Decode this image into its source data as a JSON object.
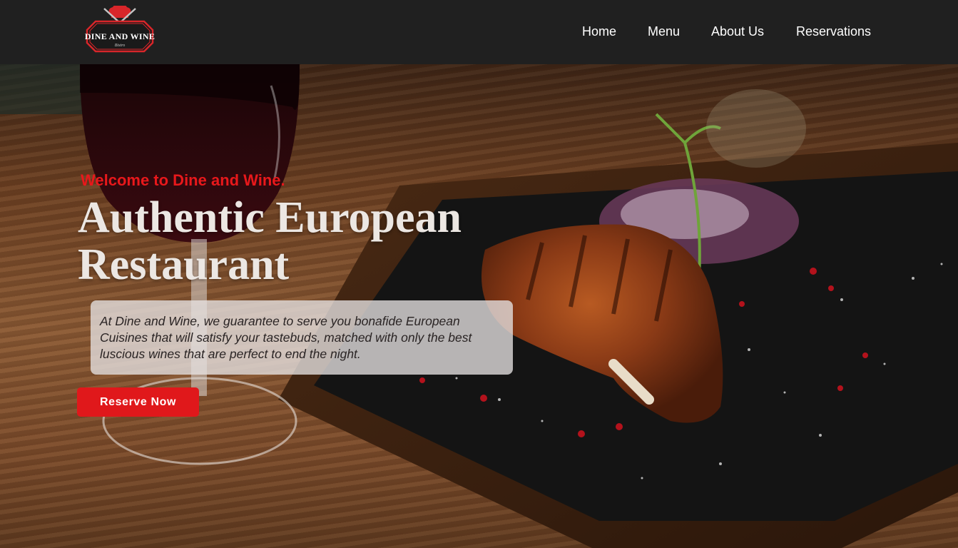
{
  "brand": {
    "logo_text": "DINE AND WINE",
    "logo_subtext": "Bistro",
    "accent_color": "#e0181b"
  },
  "nav": {
    "items": [
      {
        "label": "Home"
      },
      {
        "label": "Menu"
      },
      {
        "label": "About Us"
      },
      {
        "label": "Reservations"
      }
    ]
  },
  "hero": {
    "welcome": "Welcome to Dine and Wine.",
    "headline_line1": "Authentic European",
    "headline_line2": "Restaurant",
    "description": "At Dine and Wine, we guarantee to serve you bonafide European Cuisines that will satisfy your tastebuds, matched with only the best luscious wines that are perfect to end the night.",
    "cta_label": "Reserve Now",
    "background_image": "grilled-steak-on-slate-board-with-red-wine"
  }
}
